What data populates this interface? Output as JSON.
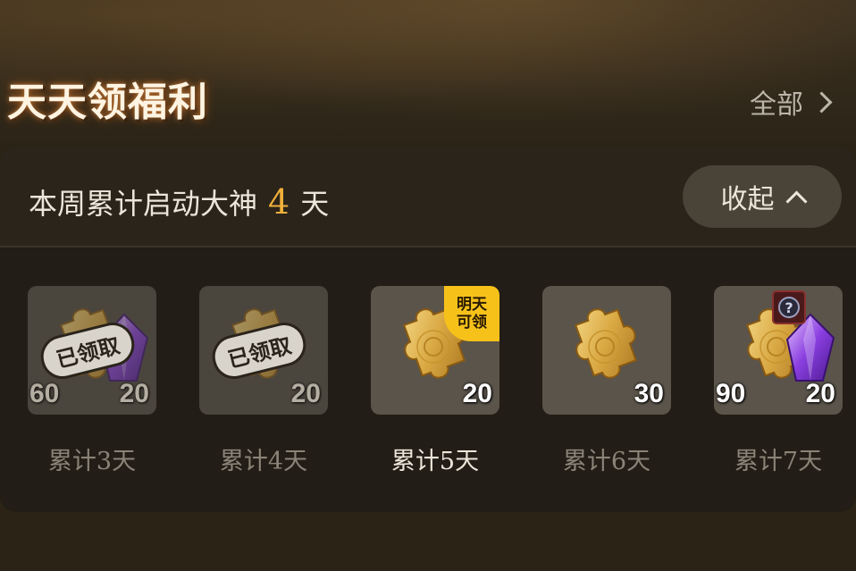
{
  "header": {
    "title": "天天领福利",
    "all_label": "全部"
  },
  "summary": {
    "prefix": "本周累计启动大神",
    "count": "4",
    "suffix": "天",
    "collapse_label": "收起"
  },
  "rewards": [
    {
      "day_label": "累计3天",
      "left_count": "60",
      "count": "20",
      "stamp": "已领取"
    },
    {
      "day_label": "累计4天",
      "count": "20",
      "stamp": "已领取"
    },
    {
      "day_label": "累计5天",
      "count": "20",
      "badge_line1": "明天",
      "badge_line2": "可领"
    },
    {
      "day_label": "累计6天",
      "count": "30"
    },
    {
      "day_label": "累计7天",
      "left_count": "90",
      "count": "20"
    }
  ],
  "colors": {
    "accent": "#f0b03a",
    "badge": "#f6c21a",
    "background": "#2a2316"
  },
  "icons": [
    "chevron-right-icon",
    "chevron-up-icon",
    "puzzle-piece-icon",
    "purple-crystal-icon",
    "mystery-badge-icon"
  ]
}
